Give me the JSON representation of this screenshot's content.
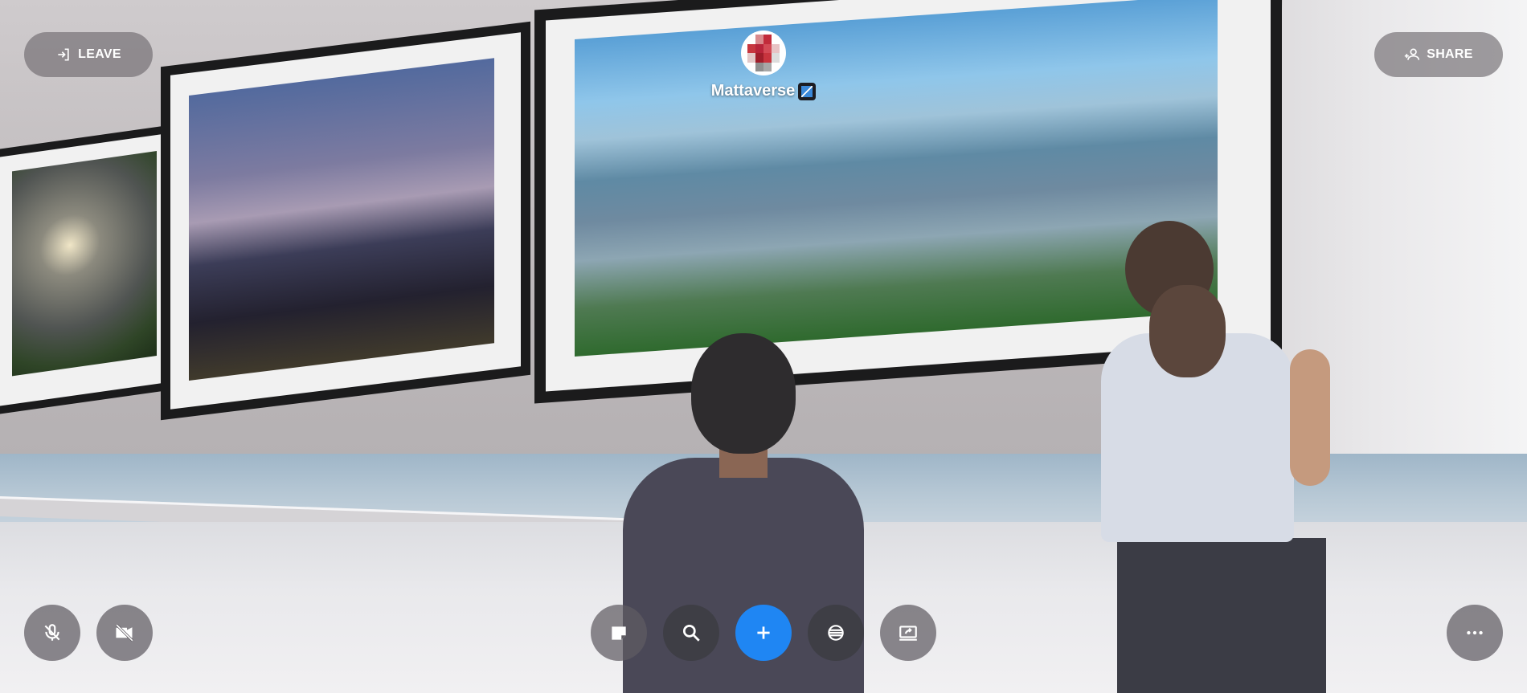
{
  "top_bar": {
    "leave_label": "LEAVE",
    "share_label": "SHARE"
  },
  "profile": {
    "name": "Mattaverse"
  },
  "bottom_left": {
    "mic": "mic-off-icon",
    "camera": "camera-off-icon"
  },
  "toolbar": {
    "items": [
      {
        "icon": "note-icon"
      },
      {
        "icon": "search-icon"
      },
      {
        "icon": "plus-icon"
      },
      {
        "icon": "globe-icon"
      },
      {
        "icon": "screen-share-icon"
      }
    ]
  },
  "bottom_right": {
    "more": "more-options-icon"
  },
  "colors": {
    "primary": "#1f86f3",
    "pill_bg": "#6e6a6e",
    "text": "#ffffff"
  }
}
